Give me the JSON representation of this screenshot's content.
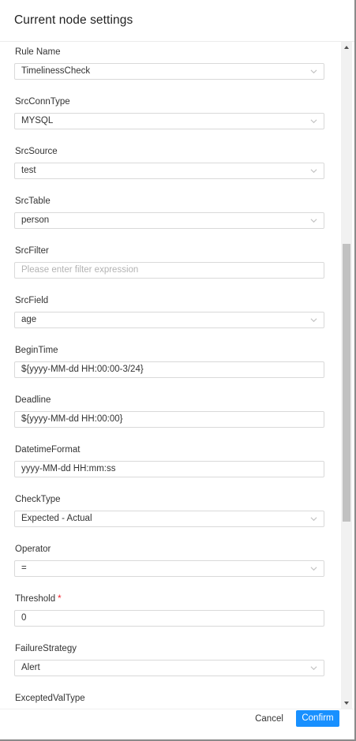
{
  "drawer": {
    "title": "Current node settings"
  },
  "fields": [
    {
      "label": "Rule Name",
      "value": "TimelinessCheck",
      "kind": "select"
    },
    {
      "label": "SrcConnType",
      "value": "MYSQL",
      "kind": "select"
    },
    {
      "label": "SrcSource",
      "value": "test",
      "kind": "select"
    },
    {
      "label": "SrcTable",
      "value": "person",
      "kind": "select"
    },
    {
      "label": "SrcFilter",
      "value": "",
      "placeholder": "Please enter filter expression",
      "kind": "input"
    },
    {
      "label": "SrcField",
      "value": "age",
      "kind": "select"
    },
    {
      "label": "BeginTime",
      "value": "${yyyy-MM-dd HH:00:00-3/24}",
      "kind": "input"
    },
    {
      "label": "Deadline",
      "value": "${yyyy-MM-dd HH:00:00}",
      "kind": "input"
    },
    {
      "label": "DatetimeFormat",
      "value": "yyyy-MM-dd HH:mm:ss",
      "kind": "input"
    },
    {
      "label": "CheckType",
      "value": "Expected - Actual",
      "kind": "select"
    },
    {
      "label": "Operator",
      "value": "=",
      "kind": "select"
    },
    {
      "label": "Threshold",
      "value": "0",
      "kind": "input",
      "required": "*"
    },
    {
      "label": "FailureStrategy",
      "value": "Alert",
      "kind": "select"
    },
    {
      "label": "ExceptedValType",
      "value": "",
      "kind": "select"
    }
  ],
  "footer": {
    "cancel_label": "Cancel",
    "confirm_label": "Confirm"
  },
  "colors": {
    "primary": "#1890ff",
    "required": "#f5222d",
    "border": "#d9d9d9"
  },
  "icons": {
    "select_arrow": "chevron-down-icon",
    "scroll_up": "scroll-up-arrow-icon",
    "scroll_down": "scroll-down-arrow-icon"
  }
}
